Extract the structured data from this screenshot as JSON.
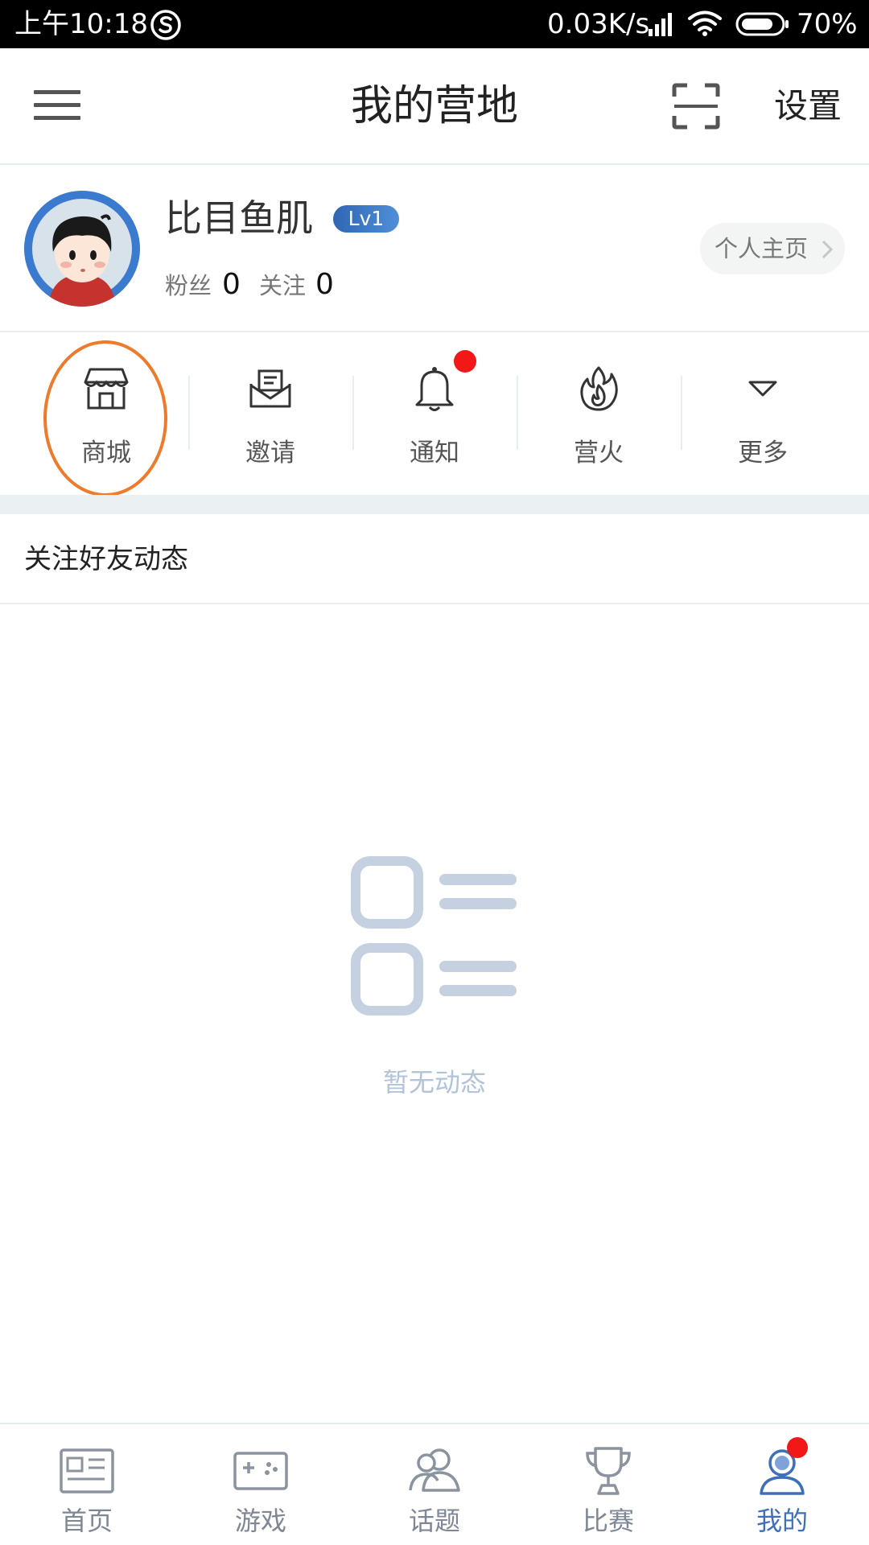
{
  "status_bar": {
    "time": "上午10:18",
    "network_speed": "0.03K/s",
    "battery": "70%",
    "icons": [
      "sogou-icon",
      "signal-icon",
      "wifi-icon",
      "battery-icon"
    ]
  },
  "header": {
    "title": "我的营地",
    "settings_label": "设置",
    "icons": [
      "menu-icon",
      "scan-icon"
    ]
  },
  "profile": {
    "username": "比目鱼肌",
    "level": "Lv1",
    "fans_label": "粉丝",
    "fans_count": "0",
    "following_label": "关注",
    "following_count": "0",
    "homepage_label": "个人主页"
  },
  "actions": [
    {
      "label": "商城",
      "icon": "shop-icon"
    },
    {
      "label": "邀请",
      "icon": "invite-envelope-icon"
    },
    {
      "label": "通知",
      "icon": "bell-icon",
      "badge": true
    },
    {
      "label": "营火",
      "icon": "campfire-icon"
    },
    {
      "label": "更多",
      "icon": "triangle-down-icon"
    }
  ],
  "feed": {
    "title": "关注好友动态",
    "empty_text": "暂无动态"
  },
  "bottom_nav": {
    "items": [
      {
        "label": "首页",
        "icon": "news-icon",
        "active": false
      },
      {
        "label": "游戏",
        "icon": "gamepad-icon",
        "active": false
      },
      {
        "label": "话题",
        "icon": "topic-people-icon",
        "active": false
      },
      {
        "label": "比赛",
        "icon": "trophy-icon",
        "active": false
      },
      {
        "label": "我的",
        "icon": "user-icon",
        "active": true,
        "badge": true
      }
    ]
  },
  "colors": {
    "accent": "#3e6fb8",
    "badge_red": "#f21818",
    "highlight_orange": "#ee7a2b",
    "empty_gray": "#b3c3d8"
  }
}
